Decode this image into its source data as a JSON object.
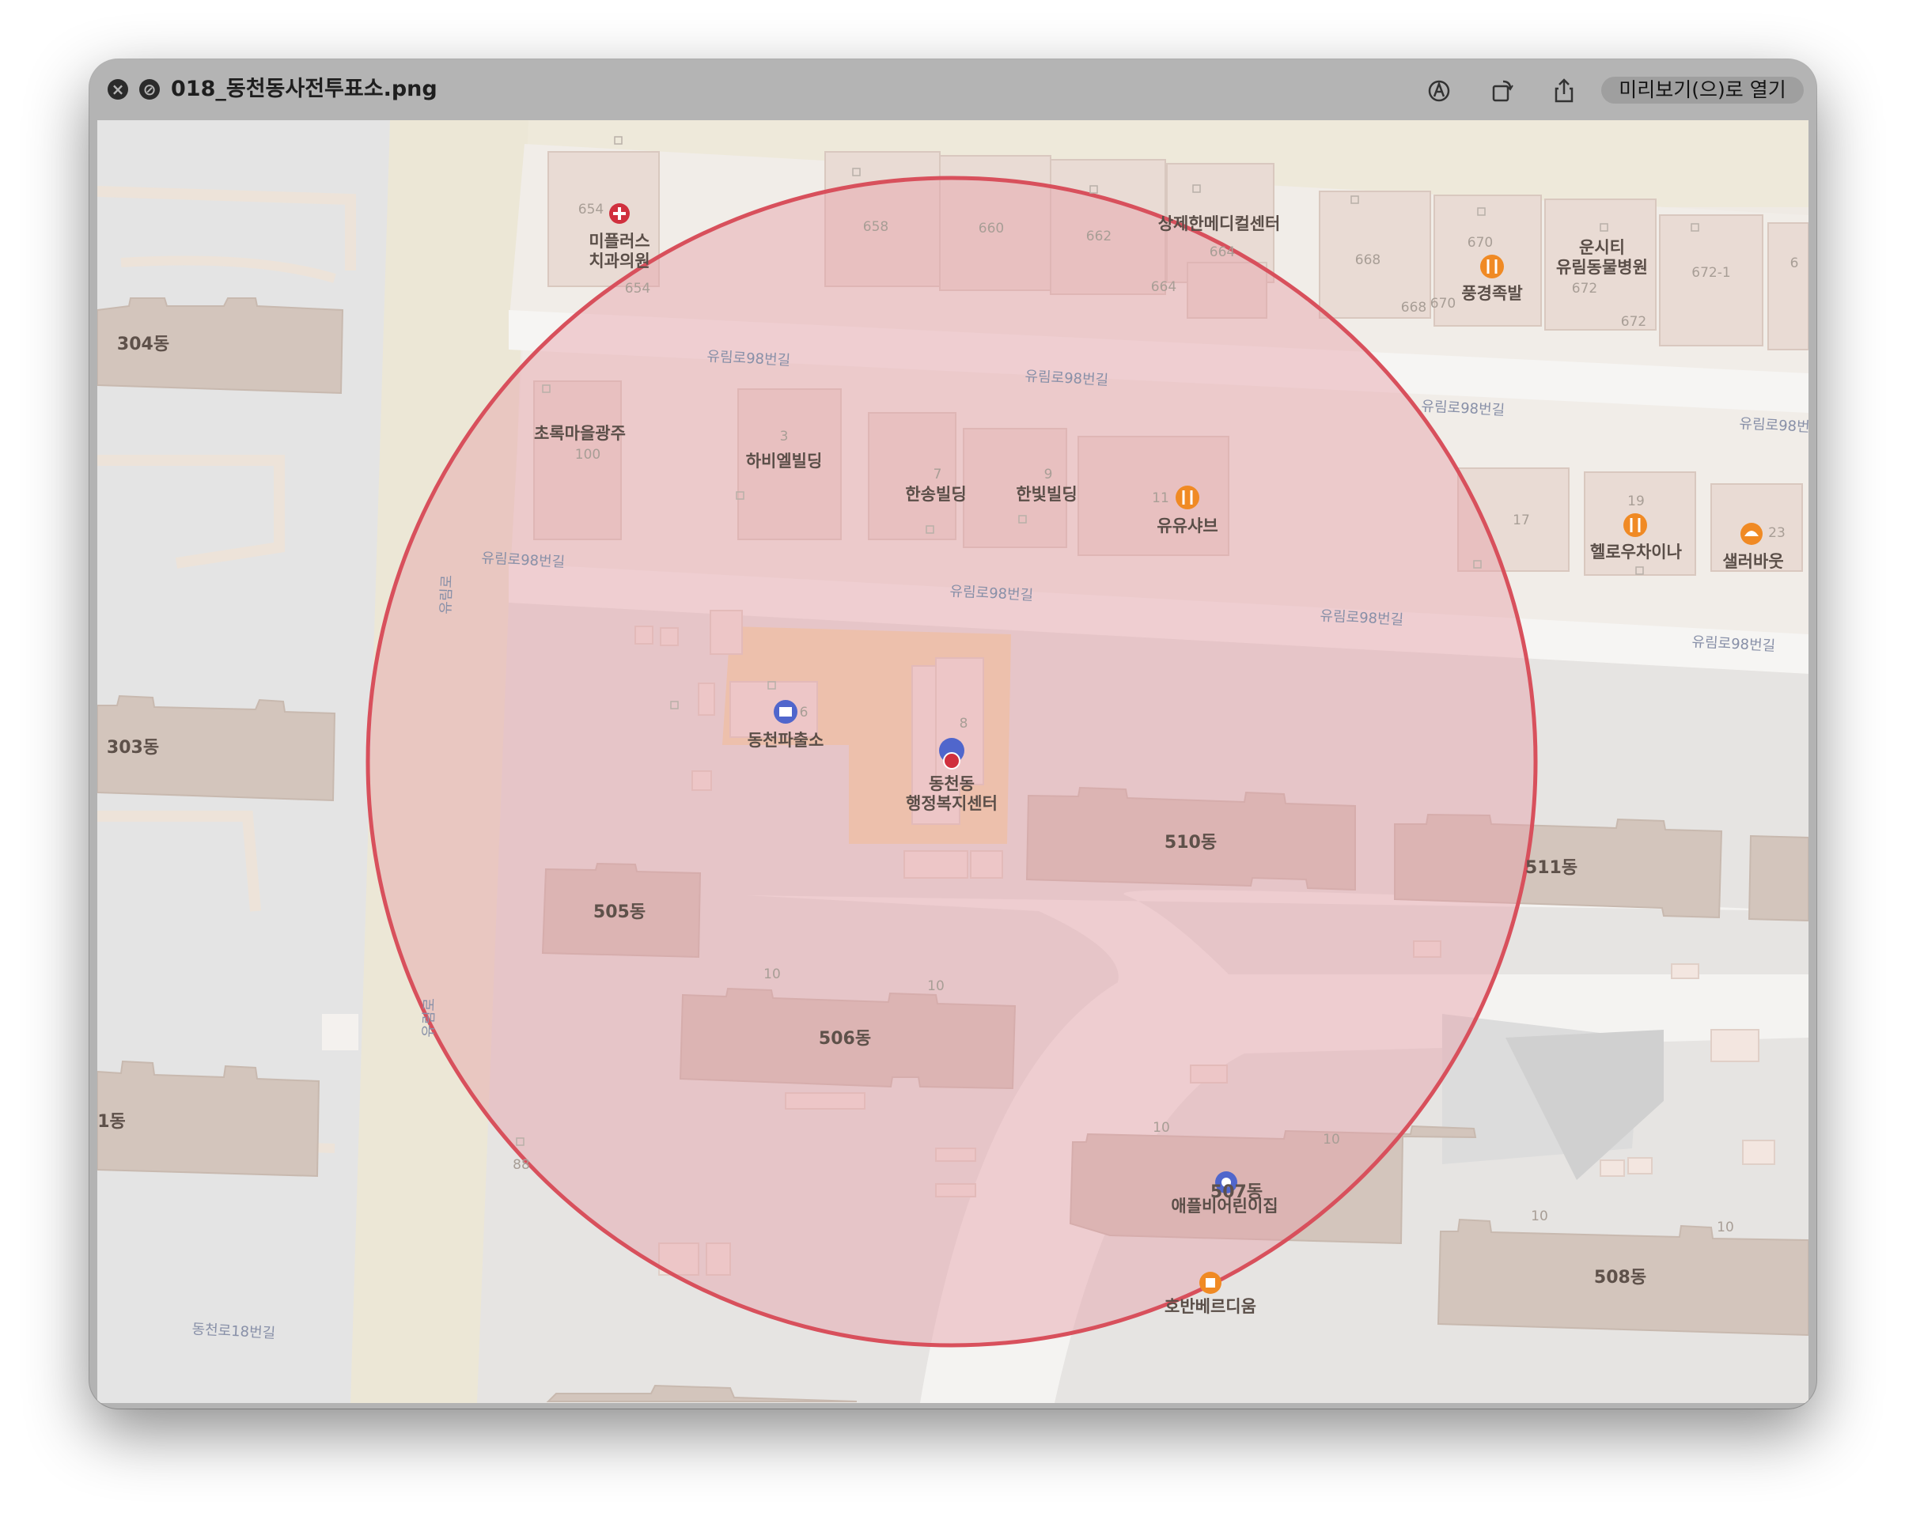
{
  "window": {
    "title": "018_동천동사전투표소.png",
    "open_button_label": "미리보기(으)로 열기",
    "controls": {
      "close": "close-icon",
      "minimize": "minimize-icon"
    },
    "toolbar_icons": [
      "markup-icon",
      "rotate-icon",
      "share-icon"
    ]
  },
  "map": {
    "colors": {
      "background": "#efeae4",
      "road": "#f5f4f2",
      "main_road": "#ece7d6",
      "residential": "#e4e4e4",
      "building": "#d3c5bc",
      "highlight_circle_fill": "#e7a0a8",
      "highlight_circle_stroke": "#d8505c",
      "public_area": "#f3dbb0"
    },
    "buildings": {
      "b304": "304동",
      "b303": "303동",
      "b1": "1동",
      "b505": "505동",
      "b506": "506동",
      "b507": "507동",
      "b508": "508동",
      "b510": "510동",
      "b511": "511동"
    },
    "pois": {
      "dental": "미플러스\n치과의원",
      "medical_center": "상제한메디컬센터",
      "restaurant1": "풍경족발",
      "vet": "운시티\n유림동물병원",
      "choroc": "초록마을광주",
      "havi": "하비엘빌딩",
      "hansong": "한송빌딩",
      "hanbit": "한빛빌딩",
      "yuyu": "유유샤브",
      "helro": "헬로우차이나",
      "salad": "샐러바웃",
      "police": "동천파출소",
      "center": "동천동\n행정복지센터",
      "kinder": "애플비어린이집",
      "hoban": "호반베르디움"
    },
    "numbers": {
      "n654a": "654",
      "n654b": "654",
      "n658": "658",
      "n660": "660",
      "n662": "662",
      "n664a": "664",
      "n664b": "664",
      "n668a": "668",
      "n668b": "668",
      "n670a": "670",
      "n670b": "670",
      "n672a": "672",
      "n672b": "672",
      "n672c": "672-1",
      "n6": "6",
      "n100": "100",
      "n3": "3",
      "n7": "7",
      "n9": "9",
      "n11": "11",
      "n17": "17",
      "n19": "19",
      "n23": "23",
      "n6b": "6",
      "n8": "8",
      "n10a": "10",
      "n10b": "10",
      "n10c": "10",
      "n10d": "10",
      "n10e": "10",
      "n10f": "10",
      "n88": "88"
    },
    "roads": {
      "r1": "유림로98번길",
      "r2": "유림로98번길",
      "r3": "유림로98번길",
      "r4": "유림로98번길",
      "r5": "유림로98번길",
      "r6": "유림로98번길",
      "r7": "유림로98번길",
      "r8": "유림로98번길",
      "v1": "유림로",
      "v2": "유림로",
      "bottom": "동천로18번길"
    }
  }
}
